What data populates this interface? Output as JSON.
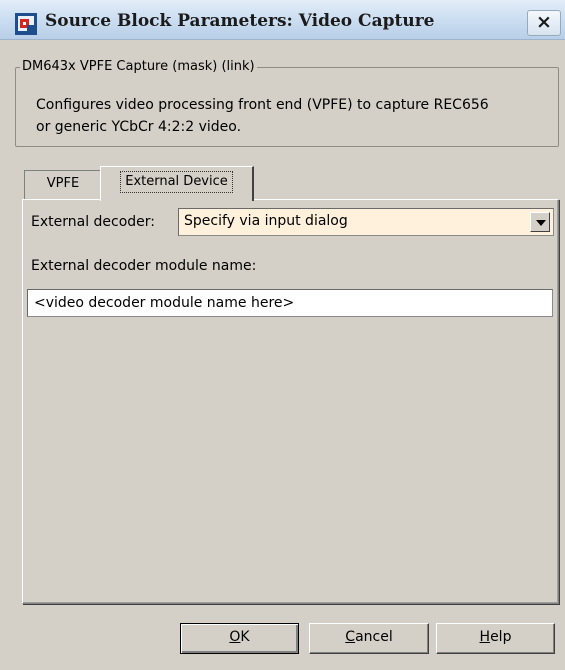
{
  "window": {
    "title": "Source Block Parameters: Video Capture",
    "close_label": "×"
  },
  "mask": {
    "legend": "DM643x VPFE Capture (mask) (link)",
    "description_line1": "Configures video processing front end (VPFE) to capture REC656",
    "description_line2": "or generic YCbCr 4:2:2 video."
  },
  "tabs": [
    {
      "label": "VPFE",
      "selected": false
    },
    {
      "label": "External Device",
      "selected": true
    }
  ],
  "external_device": {
    "decoder_label": "External decoder:",
    "decoder_value": "Specify via input dialog",
    "module_label": "External decoder module name:",
    "module_value": "<video decoder module name here>"
  },
  "buttons": {
    "ok_mnemonic": "O",
    "ok_rest": "K",
    "cancel_mnemonic": "C",
    "cancel_rest": "ancel",
    "help_mnemonic": "H",
    "help_rest": "elp"
  },
  "colors": {
    "dialog_bg": "#d4d0c8",
    "dropdown_bg": "#fff1dc"
  }
}
